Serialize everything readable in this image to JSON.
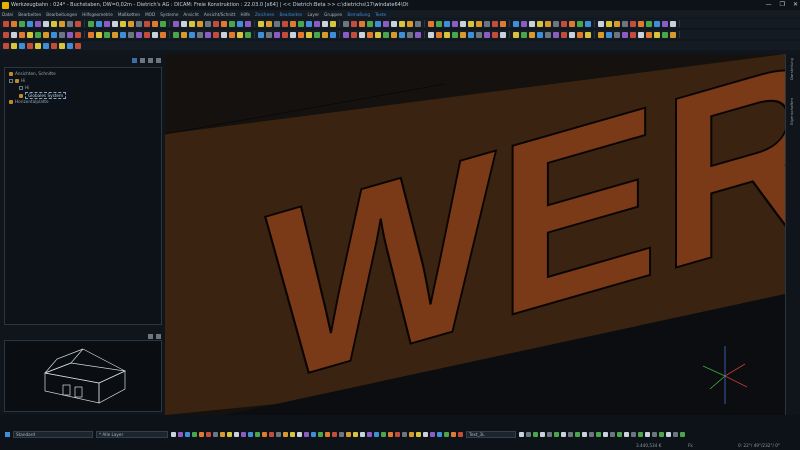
{
  "window": {
    "title": "Werkzeugbahn : 024* - Buchstaben, DW=0,02m - Dietrich's AG : DICAM: Freie Konstruktion : 22.03.0 [x64] |   << Dietrich:Beta >> c:\\dietrichs\\17\\windate64\\Ot",
    "min": "—",
    "max": "❐",
    "close": "✕"
  },
  "menu": [
    {
      "label": "Datei",
      "hl": false
    },
    {
      "label": "Bearbeiten",
      "hl": false
    },
    {
      "label": "Bearbeitungen",
      "hl": false
    },
    {
      "label": "Hilfsgeometrie",
      "hl": false
    },
    {
      "label": "Maßketten",
      "hl": false
    },
    {
      "label": "MOD",
      "hl": false
    },
    {
      "label": "Systeme",
      "hl": false
    },
    {
      "label": "Ansicht",
      "hl": false
    },
    {
      "label": "Ansicht/Schnitt",
      "hl": false
    },
    {
      "label": "Hilfe",
      "hl": false
    },
    {
      "label": "Zeichnen",
      "hl": true
    },
    {
      "label": "Bearbeiten",
      "hl": true
    },
    {
      "label": "Layer",
      "hl": false
    },
    {
      "label": "Gruppen",
      "hl": false
    },
    {
      "label": "Bemaßung",
      "hl": true
    },
    {
      "label": "Texte",
      "hl": true
    }
  ],
  "tree": {
    "items": [
      {
        "label": "Ansichten, Schnitte",
        "level": 1
      },
      {
        "label": "Hi",
        "level": 1
      },
      {
        "label": "Hi",
        "level": 2
      },
      {
        "label": "Globales System",
        "level": 2,
        "selected": true
      },
      {
        "label": "Horizontalplatte",
        "level": 1
      }
    ]
  },
  "right_tabs": [
    "Darstellung",
    "Eigenschaften"
  ],
  "viewport": {
    "text": "WERK"
  },
  "bottom": {
    "layer_style": "Standard",
    "layer_filter": "* Alle Layer",
    "text_box": "Text_3L",
    "coord1": "3.440,534 K",
    "coord2": "Fk",
    "status_right": "0: 22°/ 49°/232°/ 0°"
  },
  "colors": {
    "accent": "#3f8ed8",
    "letter": "#7a3a17",
    "plane": "#3a2411",
    "bg": "#14110f"
  }
}
